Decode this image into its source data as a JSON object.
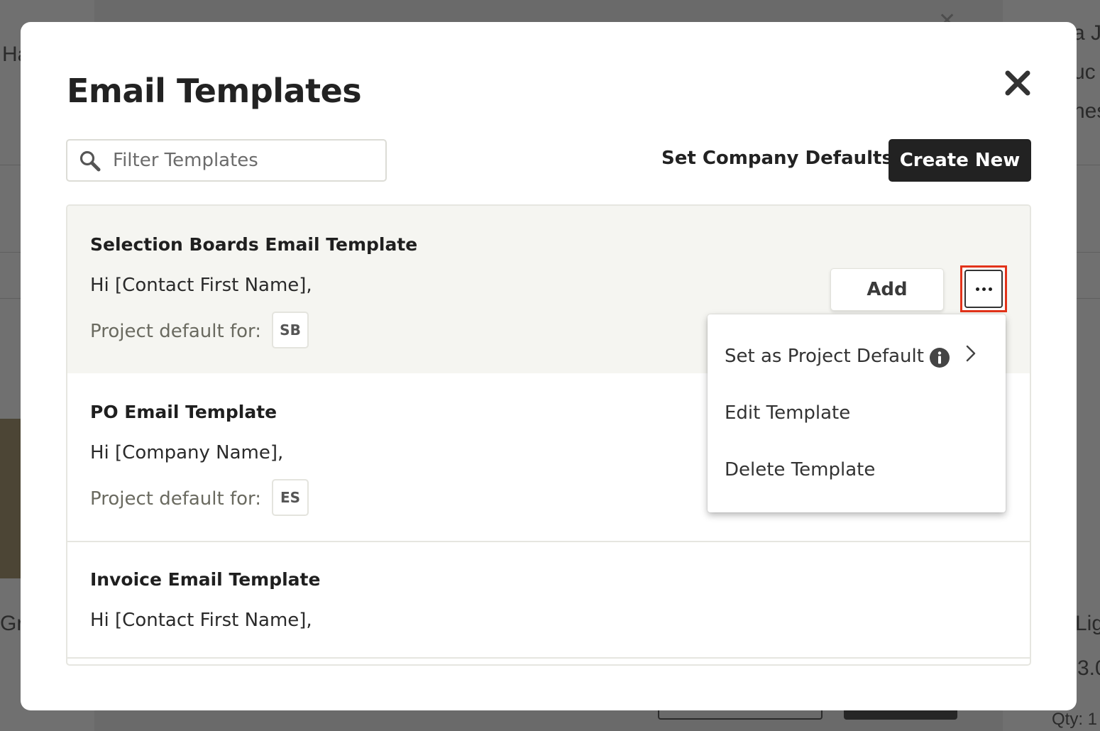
{
  "background": {
    "fragments": [
      "Ha",
      "a J",
      "uc",
      "nes",
      "Gra",
      "Lig",
      "3.0",
      "Qty: 1"
    ]
  },
  "modal": {
    "title": "Email Templates",
    "close_icon": "close-icon"
  },
  "toolbar": {
    "search_placeholder": "Filter Templates",
    "search_value": "",
    "set_defaults_label": "Set Company Defaults",
    "create_new_label": "Create New"
  },
  "templates": [
    {
      "name": "Selection Boards Email Template",
      "greeting": "Hi [Contact First Name],",
      "default_label": "Project default for:",
      "badge": "SB"
    },
    {
      "name": "PO Email Template",
      "greeting": "Hi [Company Name],",
      "default_label": "Project default for:",
      "badge": "ES"
    },
    {
      "name": "Invoice Email Template",
      "greeting": "Hi [Contact First Name],"
    }
  ],
  "row_actions": {
    "add_label": "Add",
    "more_icon": "more-dots-icon"
  },
  "menu": {
    "items": [
      {
        "label": "Set as Project Default",
        "icon": "info-icon",
        "trailing_icon": "chevron-right-icon"
      },
      {
        "label": "Edit Template"
      },
      {
        "label": "Delete Template"
      }
    ]
  },
  "colors": {
    "primary_button": "#222222",
    "highlight_outline": "#e2331a",
    "selected_row_bg": "#f5f5f1"
  }
}
